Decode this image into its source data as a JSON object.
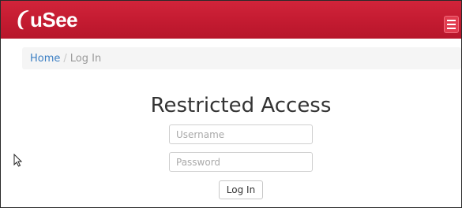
{
  "navbar": {
    "logo_text": "uSee",
    "brand_color": "#c21a30",
    "menu_icon": "hamburger-menu-icon"
  },
  "breadcrumb": {
    "home": "Home",
    "separator": "/",
    "current": "Log In"
  },
  "login": {
    "title": "Restricted Access",
    "username_placeholder": "Username",
    "password_placeholder": "Password",
    "submit_label": "Log In"
  }
}
